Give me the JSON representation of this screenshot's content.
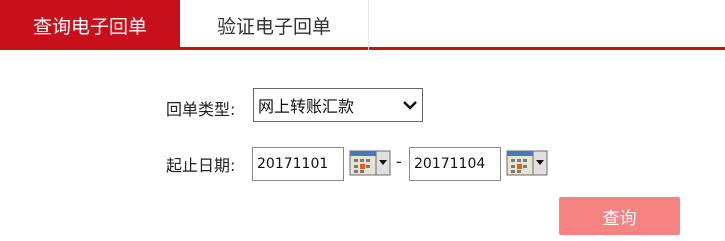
{
  "tabs": {
    "active_label": "查询电子回单",
    "inactive_label": "验证电子回单"
  },
  "form": {
    "receipt_type_label": "回单类型:",
    "receipt_type_value": "网上转账汇款",
    "date_range_label": "起止日期:",
    "start_date": "20171101",
    "end_date": "20171104",
    "date_separator": "-"
  },
  "actions": {
    "query_label": "查询"
  },
  "colors": {
    "brand_red": "#c8101d",
    "query_button": "#f78383"
  },
  "icons": {
    "calendar": "calendar-icon",
    "dropdown": "chevron-down-icon"
  }
}
